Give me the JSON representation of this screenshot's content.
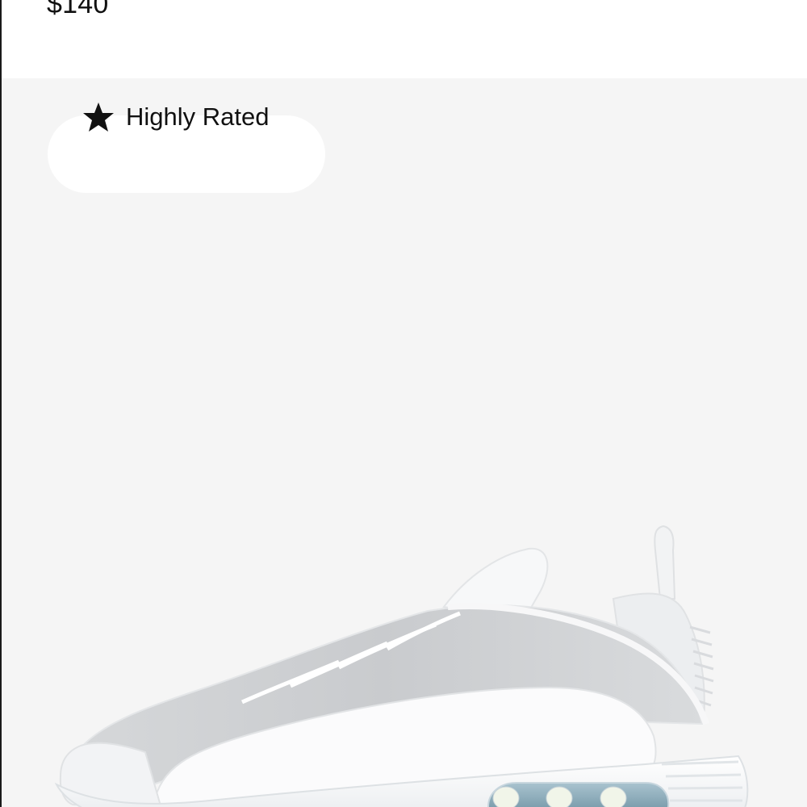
{
  "product": {
    "price": "$140",
    "badge": {
      "label": "Highly Rated",
      "icon": "star-icon"
    },
    "image": {
      "subject": "white sneaker"
    }
  },
  "colors": {
    "card_background": "#f5f5f5",
    "badge_background": "#ffffff",
    "text": "#111111",
    "air_unit": "#6f93a3"
  }
}
